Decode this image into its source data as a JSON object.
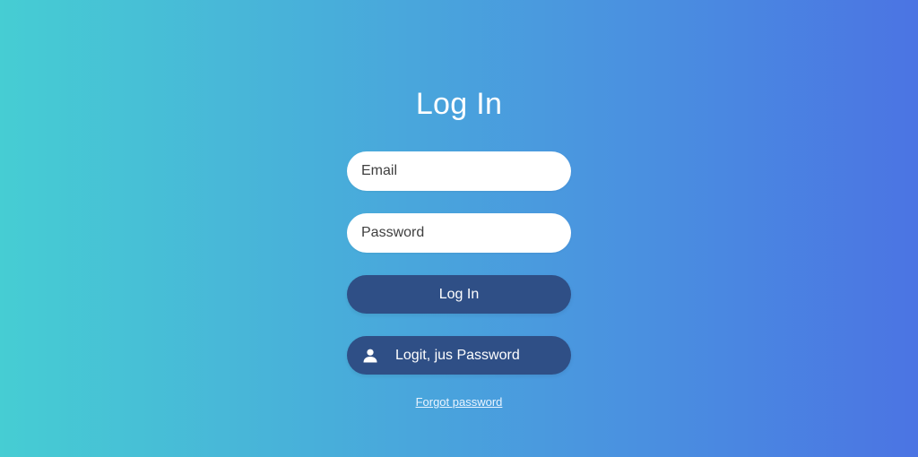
{
  "form": {
    "title": "Log In",
    "email_placeholder": "Email",
    "password_placeholder": "Password",
    "login_button_label": "Log In",
    "alt_button_label": "Logit, jus Password",
    "alt_button_icon": "user-icon",
    "footer_link": "Forgot password"
  }
}
